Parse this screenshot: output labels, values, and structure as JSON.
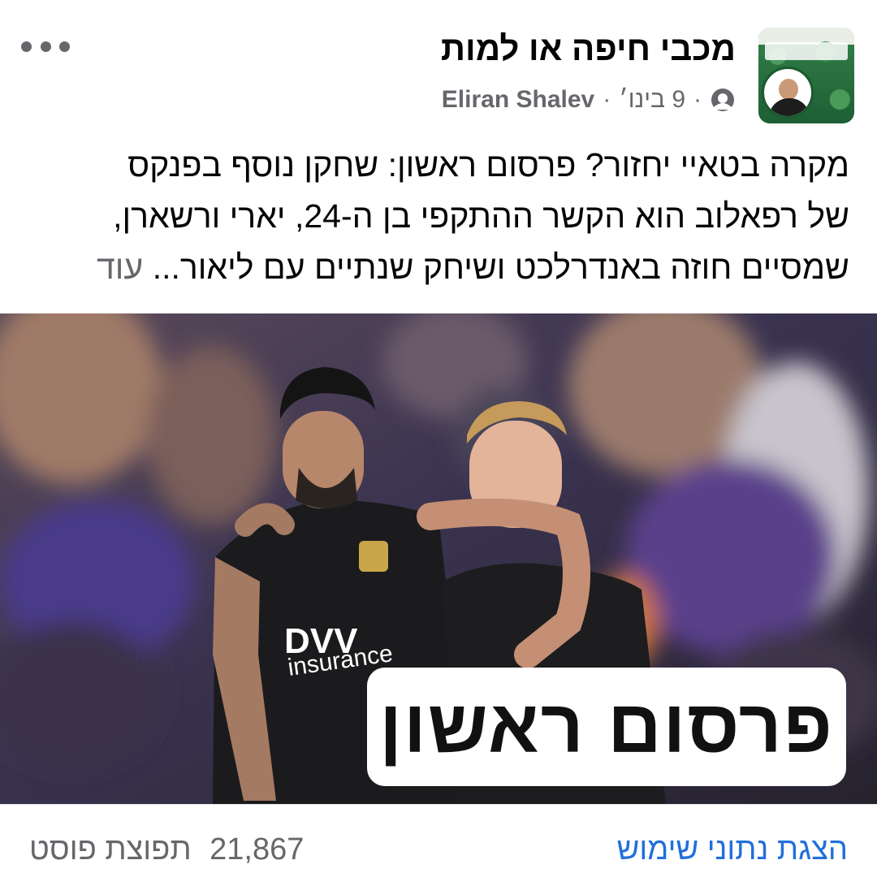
{
  "post": {
    "page_name": "מכבי חיפה או למות",
    "author": "Eliran Shalev",
    "date": "9 בינו׳",
    "separator": "·",
    "text_line1": "מקרה בטאיי יחזור? פרסום ראשון: שחקן נוסף בפנקס",
    "text_line2": "של רפאלוב הוא הקשר ההתקפי בן ה-24, יארי ורשארן,",
    "text_line3": "שמסיים חוזה באנדרלכט ושיחק שנתיים עם ליאור...",
    "see_more": "עוד"
  },
  "image": {
    "badge_text": "פרסום ראשון",
    "sponsor_line1": "DVV",
    "sponsor_line2": "insurance"
  },
  "footer": {
    "view_count": "21,867",
    "view_label": "תפוצת פוסט",
    "insights_link": "הצגת נתוני שימוש"
  },
  "colors": {
    "text": "#050505",
    "secondary": "#65676b",
    "link": "#216fdb",
    "jersey": "#1b1b1e",
    "background_purple": "#4a3a7a"
  },
  "icons": {
    "more": "more-horizontal-icon",
    "audience": "globe-icon"
  }
}
